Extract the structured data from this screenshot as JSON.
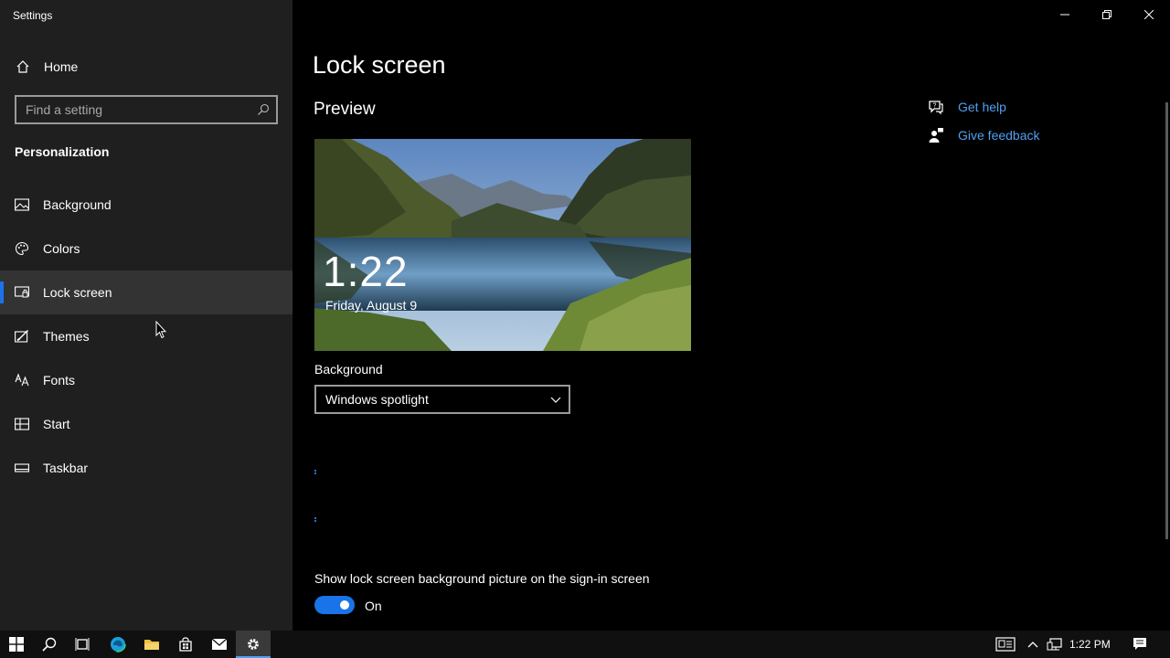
{
  "window": {
    "title": "Settings"
  },
  "sidebar": {
    "home_label": "Home",
    "search_placeholder": "Find a setting",
    "section": "Personalization",
    "items": [
      {
        "label": "Background",
        "icon": "picture-icon"
      },
      {
        "label": "Colors",
        "icon": "palette-icon"
      },
      {
        "label": "Lock screen",
        "icon": "lock-screen-icon",
        "selected": true
      },
      {
        "label": "Themes",
        "icon": "themes-icon"
      },
      {
        "label": "Fonts",
        "icon": "fonts-icon"
      },
      {
        "label": "Start",
        "icon": "start-icon"
      },
      {
        "label": "Taskbar",
        "icon": "taskbar-icon"
      }
    ]
  },
  "main": {
    "title": "Lock screen",
    "preview_title": "Preview",
    "preview_time": "1:22",
    "preview_date": "Friday, August 9",
    "background_label": "Background",
    "background_value": "Windows spotlight",
    "show_signin_label": "Show lock screen background picture on the sign-in screen",
    "toggle_state": "On"
  },
  "help": {
    "get_help": "Get help",
    "give_feedback": "Give feedback"
  },
  "taskbar": {
    "clock": "1:22 PM"
  },
  "colors": {
    "accent": "#1a73e8",
    "link": "#4fa0f0",
    "sidebar_bg": "#1f1f1f",
    "selected_bg": "#333333"
  }
}
